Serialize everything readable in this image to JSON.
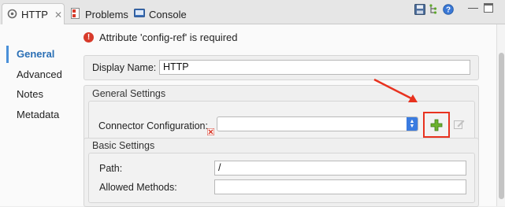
{
  "tabs": [
    {
      "label": "HTTP",
      "icon": "http-connector-icon",
      "active": true
    },
    {
      "label": "Problems",
      "icon": "problems-icon",
      "active": false
    },
    {
      "label": "Console",
      "icon": "console-icon",
      "active": false
    }
  ],
  "sidebar": {
    "items": [
      {
        "label": "General",
        "selected": true
      },
      {
        "label": "Advanced",
        "selected": false
      },
      {
        "label": "Notes",
        "selected": false
      },
      {
        "label": "Metadata",
        "selected": false
      }
    ]
  },
  "error": {
    "message": "Attribute 'config-ref' is required"
  },
  "display_name": {
    "label": "Display Name:",
    "value": "HTTP"
  },
  "general_settings": {
    "title": "General Settings",
    "connector_label": "Connector Configuration:",
    "connector_value": ""
  },
  "basic_settings": {
    "title": "Basic Settings",
    "path_label": "Path:",
    "path_value": "/",
    "methods_label": "Allowed Methods:",
    "methods_value": ""
  },
  "colors": {
    "accent": "#4a90d9",
    "annotation": "#e8321f",
    "error": "#d73a2a",
    "add_icon": "#5fa82b"
  }
}
